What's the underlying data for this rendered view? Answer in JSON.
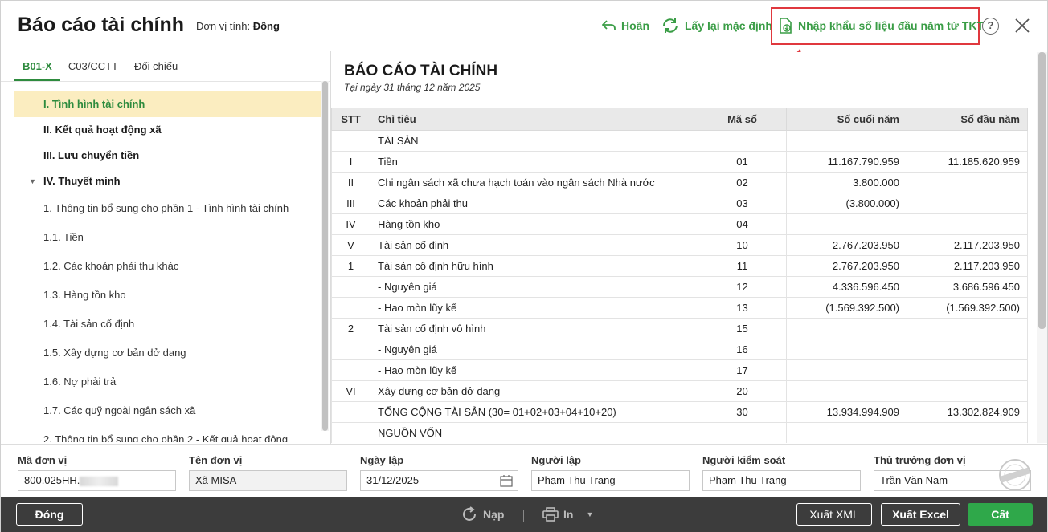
{
  "header": {
    "title": "Báo cáo tài chính",
    "unit_label": "Đơn vị tính:",
    "unit_value": "Đồng",
    "undo_label": "Hoãn",
    "reset_label": "Lấy lại mặc định",
    "import_label": "Nhập khẩu số liệu đầu năm từ TKT",
    "help_glyph": "?"
  },
  "tabs": [
    {
      "label": "B01-X",
      "active": true
    },
    {
      "label": "C03/CCTT",
      "active": false
    },
    {
      "label": "Đối chiếu",
      "active": false
    }
  ],
  "tree": [
    {
      "label": "I. Tình hình tài chính",
      "bold": true,
      "selected": true
    },
    {
      "label": "II. Kết quả hoạt động xã",
      "bold": true
    },
    {
      "label": "III. Lưu chuyển tiền",
      "bold": true
    },
    {
      "label": "IV. Thuyết minh",
      "bold": true,
      "expanded": true
    },
    {
      "label": "1. Thông tin bổ sung cho phần 1 - Tình hình tài chính"
    },
    {
      "label": "1.1. Tiền"
    },
    {
      "label": "1.2. Các khoản phải thu khác"
    },
    {
      "label": "1.3. Hàng tồn kho"
    },
    {
      "label": "1.4. Tài sản cố định"
    },
    {
      "label": "1.5. Xây dựng cơ bản dở dang"
    },
    {
      "label": "1.6. Nợ phải trả"
    },
    {
      "label": "1.7. Các quỹ ngoài ngân sách xã"
    },
    {
      "label": "2. Thông tin bổ sung cho phần 2 - Kết quả hoạt động"
    }
  ],
  "report": {
    "title": "BÁO CÁO TÀI CHÍNH",
    "date": "Tại ngày 31 tháng 12 năm 2025",
    "columns": [
      "STT",
      "Chỉ tiêu",
      "Mã số",
      "Số cuối năm",
      "Số đầu năm"
    ],
    "rows": [
      [
        "",
        "TÀI SẢN",
        "",
        "",
        ""
      ],
      [
        "I",
        "Tiền",
        "01",
        "11.167.790.959",
        "11.185.620.959"
      ],
      [
        "II",
        "Chi ngân sách xã chưa hạch toán vào ngân sách Nhà nước",
        "02",
        "3.800.000",
        ""
      ],
      [
        "III",
        "Các khoản phải thu",
        "03",
        "(3.800.000)",
        ""
      ],
      [
        "IV",
        "Hàng tồn kho",
        "04",
        "",
        ""
      ],
      [
        "V",
        "Tài sản cố định",
        "10",
        "2.767.203.950",
        "2.117.203.950"
      ],
      [
        "1",
        "Tài sản cố định hữu hình",
        "11",
        "2.767.203.950",
        "2.117.203.950"
      ],
      [
        "",
        "- Nguyên giá",
        "12",
        "4.336.596.450",
        "3.686.596.450"
      ],
      [
        "",
        "- Hao mòn lũy kế",
        "13",
        "(1.569.392.500)",
        "(1.569.392.500)"
      ],
      [
        "2",
        "Tài sản cố định vô hình",
        "15",
        "",
        ""
      ],
      [
        "",
        "- Nguyên giá",
        "16",
        "",
        ""
      ],
      [
        "",
        "- Hao mòn lũy kế",
        "17",
        "",
        ""
      ],
      [
        "VI",
        "Xây dựng cơ bản dở dang",
        "20",
        "",
        ""
      ],
      [
        "",
        "TỔNG CỘNG TÀI SẢN (30= 01+02+03+04+10+20)",
        "30",
        "13.934.994.909",
        "13.302.824.909"
      ],
      [
        "",
        "NGUỒN VỐN",
        "",
        "",
        ""
      ]
    ]
  },
  "form": {
    "unit_code_label": "Mã đơn vị",
    "unit_code_value": "800.025HH.",
    "unit_name_label": "Tên đơn vị",
    "unit_name_value": "Xã MISA",
    "date_label": "Ngày lập",
    "date_value": "31/12/2025",
    "preparer_label": "Người lập",
    "preparer_value": "Phạm Thu Trang",
    "controller_label": "Người kiểm soát",
    "controller_value": "Phạm Thu Trang",
    "head_label": "Thủ trưởng đơn vị",
    "head_value": "Trần Văn Nam"
  },
  "footer": {
    "close_label": "Đóng",
    "reload_label": "Nạp",
    "print_label": "In",
    "export_xml_label": "Xuất XML",
    "export_excel_label": "Xuất Excel",
    "save_label": "Cất"
  },
  "colors": {
    "accent_green": "#2e8b3e",
    "highlight_red": "#e0383e",
    "selected_bg": "#fbedc0",
    "footer_bg": "#3c3c3c",
    "save_green": "#2fa84a"
  }
}
